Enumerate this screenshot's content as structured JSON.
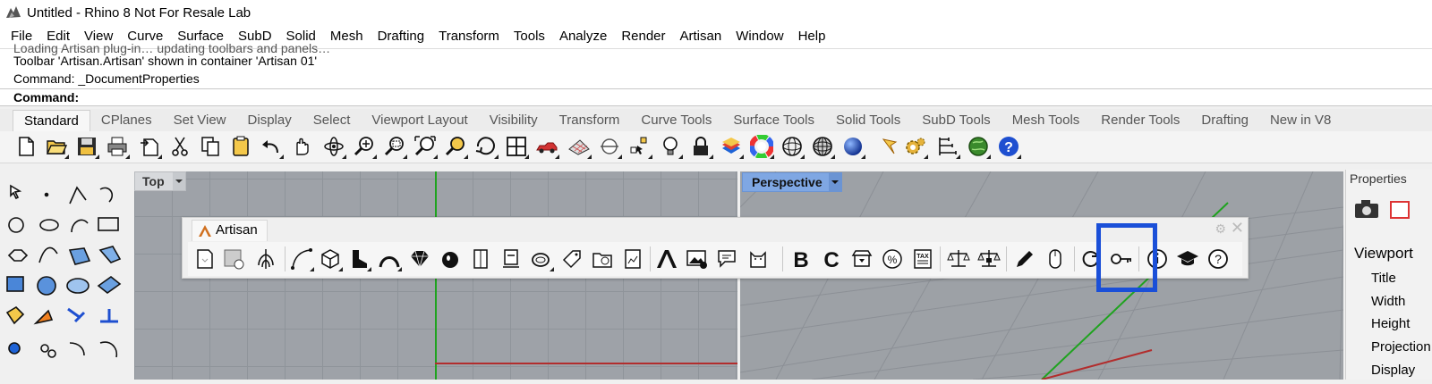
{
  "window": {
    "title": "Untitled - Rhino 8 Not For Resale Lab"
  },
  "menu": [
    "File",
    "Edit",
    "View",
    "Curve",
    "Surface",
    "SubD",
    "Solid",
    "Mesh",
    "Drafting",
    "Transform",
    "Tools",
    "Analyze",
    "Render",
    "Artisan",
    "Window",
    "Help"
  ],
  "command": {
    "history_cut": "Loading Artisan plug-in… updating toolbars and panels…",
    "history": [
      "Toolbar 'Artisan.Artisan' shown in container 'Artisan 01'",
      "Command: _DocumentProperties"
    ],
    "prompt_label": "Command:",
    "input_value": ""
  },
  "toolbar_tabs": [
    "Standard",
    "CPlanes",
    "Set View",
    "Display",
    "Select",
    "Viewport Layout",
    "Visibility",
    "Transform",
    "Curve Tools",
    "Surface Tools",
    "Solid Tools",
    "SubD Tools",
    "Mesh Tools",
    "Render Tools",
    "Drafting",
    "New in V8"
  ],
  "active_tab": "Standard",
  "standard_icons": [
    "new-icon",
    "open-icon",
    "save-icon",
    "print-icon",
    "import-icon",
    "cut-icon",
    "copy-icon",
    "paste-icon",
    "undo-icon",
    "pan-icon",
    "rotate-view-icon",
    "zoom-icon",
    "zoom-window-icon",
    "zoom-extents-icon",
    "zoom-selected-icon",
    "named-views-icon",
    "four-viewports-icon",
    "car-icon",
    "grid-icon",
    "point-icon",
    "selection-icon",
    "light-icon",
    "lock-icon",
    "layer-icon",
    "color-wheel-icon",
    "wireframe-sphere-icon",
    "mesh-sphere-icon",
    "render-sphere-icon",
    "flag-icon",
    "options-gear-icon",
    "dimension-icon",
    "globe-icon",
    "help-icon"
  ],
  "viewports": {
    "top": {
      "label": "Top"
    },
    "perspective": {
      "label": "Perspective"
    }
  },
  "properties_panel": {
    "header": "Properties",
    "section": "Viewport",
    "rows": [
      "Title",
      "Width",
      "Height",
      "Projection",
      "Display"
    ]
  },
  "artisan_toolbar": {
    "tab_label": "Artisan",
    "icons": [
      "document-icon",
      "save-web-icon",
      "tree-icon",
      "curve-icon",
      "cube-icon",
      "boot-icon",
      "arch-icon",
      "diamond-icon",
      "vase-icon",
      "door-icon",
      "stand-icon",
      "ring-icon",
      "tag-icon",
      "folder-user-icon",
      "texture-icon",
      "logo-a-icon",
      "image-icon",
      "chat-icon",
      "cat-icon",
      "bold-b-icon",
      "c-icon",
      "store-icon",
      "percent-badge-icon",
      "tax-icon",
      "scale-icon",
      "scale-alt-icon",
      "pencil-icon",
      "mouse-icon",
      "refresh-icon",
      "key-icon",
      "info-icon",
      "graduation-cap-icon",
      "help-circle-icon"
    ],
    "highlighted": "key-icon",
    "highlight_color": "#1a4fd8"
  },
  "colors": {
    "viewport_bg": "#9ea2a8",
    "active_viewport_label": "#7fa7e3",
    "y_axis": "#1fa31f",
    "x_axis": "#b22d2d"
  }
}
